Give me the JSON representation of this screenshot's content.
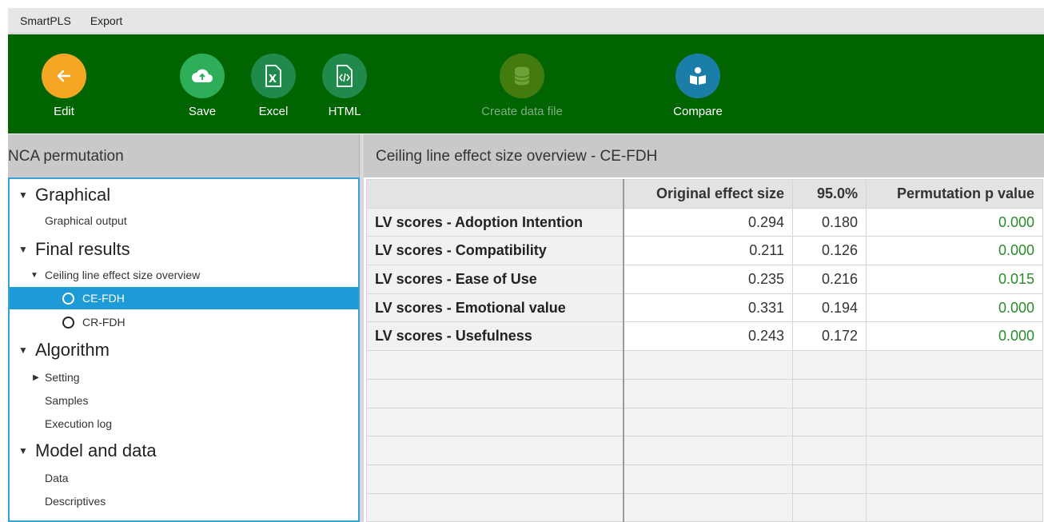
{
  "menubar": {
    "items": [
      "SmartPLS",
      "Export"
    ]
  },
  "toolbar": {
    "edit": "Edit",
    "save": "Save",
    "excel": "Excel",
    "html": "HTML",
    "create_data_file": "Create data file",
    "compare": "Compare"
  },
  "left_panel": {
    "title": "NCA permutation",
    "tree": {
      "graphical": "Graphical",
      "graphical_output": "Graphical output",
      "final_results": "Final results",
      "ceiling_overview": "Ceiling line effect size overview",
      "ce_fdh": "CE-FDH",
      "cr_fdh": "CR-FDH",
      "algorithm": "Algorithm",
      "setting": "Setting",
      "samples": "Samples",
      "execution_log": "Execution log",
      "model_and_data": "Model and data",
      "data": "Data",
      "descriptives": "Descriptives"
    }
  },
  "right_panel": {
    "title": "Ceiling line effect size overview - CE-FDH",
    "columns": [
      "",
      "Original effect size",
      "95.0%",
      "Permutation p value"
    ],
    "rows": [
      {
        "label": "LV scores - Adoption Intention",
        "effect": "0.294",
        "pct": "0.180",
        "p": "0.000"
      },
      {
        "label": "LV scores - Compatibility",
        "effect": "0.211",
        "pct": "0.126",
        "p": "0.000"
      },
      {
        "label": "LV scores - Ease of Use",
        "effect": "0.235",
        "pct": "0.216",
        "p": "0.015"
      },
      {
        "label": "LV scores - Emotional value",
        "effect": "0.331",
        "pct": "0.194",
        "p": "0.000"
      },
      {
        "label": "LV scores - Usefulness",
        "effect": "0.243",
        "pct": "0.172",
        "p": "0.000"
      }
    ]
  },
  "colors": {
    "toolbar_bg": "#006400",
    "selected_bg": "#1e9ad6",
    "edit_icon": "#f5a623",
    "save_icon": "#2fae5a",
    "excel_icon": "#1f8a4c",
    "html_icon": "#1f8a4c",
    "create_icon": "#7a8f1a",
    "compare_icon": "#1b7ea8",
    "p_value_text": "#2a8a2a"
  },
  "icons": {
    "edit": "arrow-left-icon",
    "save": "cloud-upload-icon",
    "excel": "excel-file-icon",
    "html": "html-file-icon",
    "create_data_file": "database-icon",
    "compare": "compare-book-icon"
  }
}
